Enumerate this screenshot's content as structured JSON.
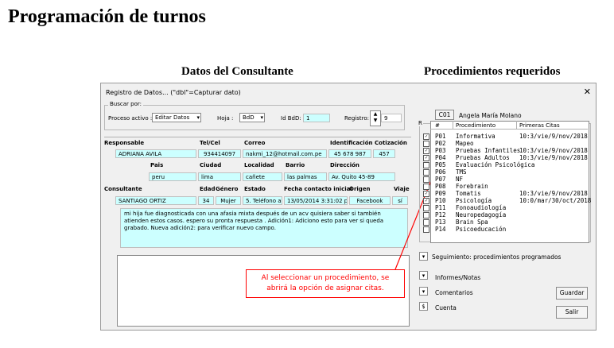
{
  "page_title": "Programación de turnos",
  "section_titles": {
    "consultante": "Datos del Consultante",
    "procedimientos": "Procedimientos requeridos"
  },
  "window": {
    "title": "Registro de Datos... (\"dbl\"=Capturar dato)",
    "close_glyph": "✕",
    "buscar_por": "Buscar por:",
    "proceso_label": "Proceso activo :",
    "proceso_value": "Editar Datos",
    "hoja_label": "Hoja :",
    "hoja_value": "BdD",
    "idbd_label": "Id BdD:",
    "idbd_value": "1",
    "registro_label": "Registro:",
    "registro_value": "9"
  },
  "responsable": {
    "headers": [
      "Responsable",
      "Tel/Cel",
      "Correo",
      "Identificación",
      "Cotización"
    ],
    "values": [
      "ADRIANA AVILA",
      "934414097",
      "nakmi_12@hotmail.com.pe",
      "45 678 987",
      "457"
    ]
  },
  "ubicacion": {
    "headers": [
      "Pais",
      "Ciudad",
      "Localidad",
      "Barrio",
      "Dirección"
    ],
    "values": [
      "peru",
      "lima",
      "cañete",
      "las palmas",
      "Av. Quito 45-89"
    ]
  },
  "consultante": {
    "headers": [
      "Consultante",
      "Edad",
      "Género",
      "Estado",
      "Fecha contacto inicial",
      "Origen",
      "Viaje"
    ],
    "values": [
      "SANTIAGO ORTIZ",
      "34",
      "Mujer",
      "5. Teléfono ap",
      "13/05/2014 3:31:02 p.m",
      "Facebook",
      "sí"
    ]
  },
  "notes": "mi hija fue diagnosticada con una afasia mixta después de un acv quisiera saber si también atienden estos casos. espero su pronta respuesta . Adición1: Adiciono esto para ver si queda grabado. Nueva adición2: para verificar nuevo campo.",
  "annotation": "Al seleccionar un procedimiento, se abrirá la opción de asignar citas.",
  "patient": {
    "code": "C01",
    "name": "Angela María Molano"
  },
  "procedures": {
    "r_label": "R",
    "headers": [
      "#",
      "Procedimiento",
      "Primeras Citas"
    ],
    "rows": [
      {
        "checked": true,
        "code": "P01",
        "name": "Informativa",
        "citas": "10:3/vie/9/nov/2018"
      },
      {
        "checked": false,
        "code": "P02",
        "name": "Mapeo",
        "citas": ""
      },
      {
        "checked": true,
        "code": "P03",
        "name": "Pruebas Infantiles",
        "citas": "10:3/vie/9/nov/2018"
      },
      {
        "checked": true,
        "code": "P04",
        "name": "Pruebas Adultos",
        "citas": "10:3/vie/9/nov/2018"
      },
      {
        "checked": false,
        "code": "P05",
        "name": "Evaluación Psicológica",
        "citas": ""
      },
      {
        "checked": false,
        "code": "P06",
        "name": "TMS",
        "citas": ""
      },
      {
        "checked": false,
        "code": "P07",
        "name": "NF",
        "citas": ""
      },
      {
        "checked": false,
        "code": "P08",
        "name": "Forebrain",
        "citas": ""
      },
      {
        "checked": true,
        "code": "P09",
        "name": "Tomatis",
        "citas": "10:3/vie/9/nov/2018"
      },
      {
        "checked": true,
        "code": "P10",
        "name": "Psicología",
        "citas": "10:0/mar/30/oct/2018"
      },
      {
        "checked": false,
        "code": "P11",
        "name": "Fonoaudiología",
        "citas": ""
      },
      {
        "checked": false,
        "code": "P12",
        "name": "Neuropedagogía",
        "citas": ""
      },
      {
        "checked": false,
        "code": "P13",
        "name": "Brain Spa",
        "citas": ""
      },
      {
        "checked": false,
        "code": "P14",
        "name": "Psicoeducación",
        "citas": ""
      }
    ]
  },
  "side": {
    "seguimiento": "Seguimiento: procedimientos programados",
    "informes": "Informes/Notas",
    "comentarios": "Comentarios",
    "cuenta": "Cuenta",
    "cuenta_symbol": "$",
    "guardar": "Guardar",
    "salir": "Salir"
  },
  "colors": {
    "field_bg": "#ccffff",
    "annotation": "#ff0000"
  }
}
